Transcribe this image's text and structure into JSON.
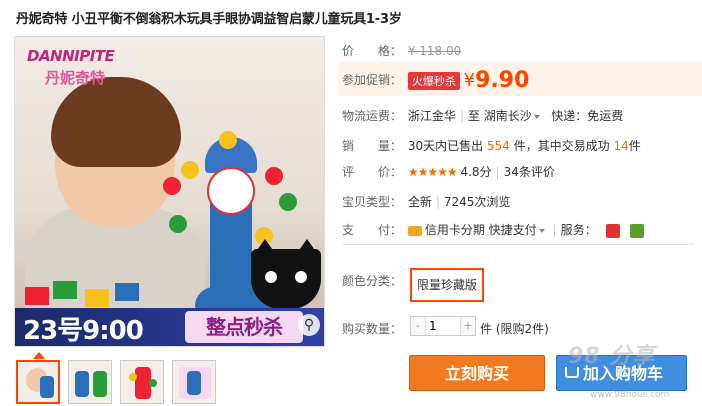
{
  "product": {
    "title": "丹妮奇特 小丑平衡不倒翁积木玩具手眼协调益智启蒙儿童玩具1-3岁"
  },
  "image": {
    "brand_en": "DANNIPITE",
    "brand_cn": "丹妮奇特",
    "promo_time": "23号9:00",
    "promo_tag": "整点秒杀",
    "zoom_icon": "magnifier-icon"
  },
  "price": {
    "label": "价　　格：",
    "original": "¥ 118.00"
  },
  "promotion": {
    "label": "参加促销：",
    "tag": "火爆秒杀",
    "currency": "¥",
    "value": "9.90"
  },
  "shipping": {
    "label": "物流运费：",
    "from": "浙江金华",
    "to_prefix": "至",
    "to": "湖南长沙",
    "delivery": "快递：免运费"
  },
  "sales": {
    "label": "销　　量：",
    "text1": "30天内已售出",
    "sold": "554",
    "text2": "件，其中交易成功",
    "success": "14",
    "text3": "件"
  },
  "rating": {
    "label": "评　　价：",
    "stars": "★★★★★",
    "score": "4.8分",
    "reviews": "34条评价",
    "value": 4.8
  },
  "type": {
    "label": "宝贝类型：",
    "condition": "全新",
    "views": "7245次浏览"
  },
  "payment": {
    "label": "支　　付：",
    "credit": "信用卡分期",
    "quick": "快捷支付",
    "service_label": "服务："
  },
  "color": {
    "label": "颜色分类：",
    "selected": "限量珍藏版"
  },
  "quantity": {
    "label": "购买数量：",
    "minus": "-",
    "value": "1",
    "plus": "+",
    "unit": "件",
    "limit": "(限购2件)"
  },
  "actions": {
    "buy": "立刻购买",
    "cart": "加入购物车"
  },
  "watermark": {
    "text": "98 分享",
    "sub": "www.98hous.com"
  },
  "colors": {
    "accent": "#ff4400",
    "buy_button": "#f37a1e",
    "cart_button": "#3f8ee2",
    "promo_bg": "#fff2e8"
  }
}
